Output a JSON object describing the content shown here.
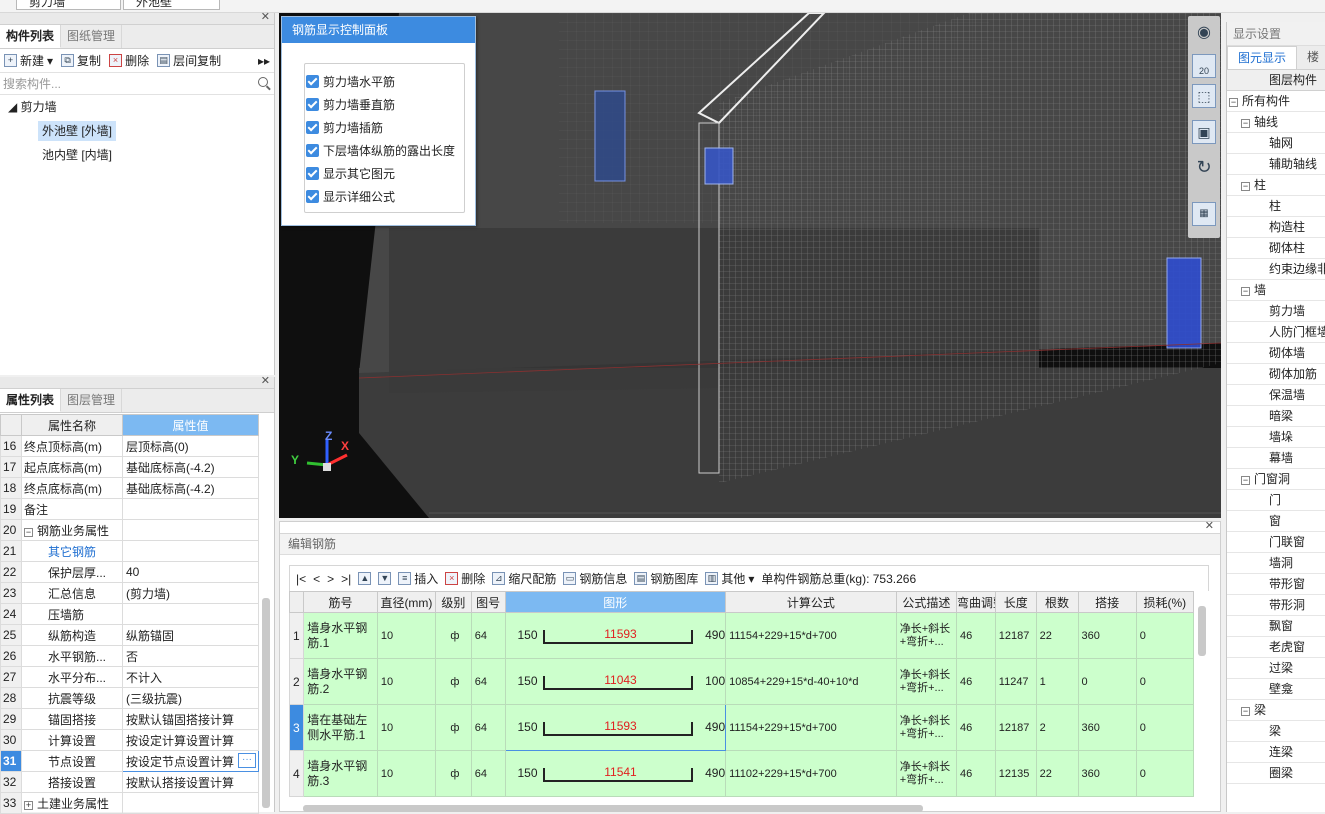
{
  "top": {
    "sel1": "剪力墙",
    "sel2": "外池壁"
  },
  "left": {
    "tabs": [
      "构件列表",
      "图纸管理"
    ],
    "toolbar": {
      "new": "新建",
      "copy": "复制",
      "delete": "删除",
      "floor_copy": "层间复制"
    },
    "search_placeholder": "搜索构件...",
    "tree_root": "剪力墙",
    "tree_items": [
      "外池壁 [外墙]",
      "池内壁 [内墙]"
    ]
  },
  "props": {
    "tabs": [
      "属性列表",
      "图层管理"
    ],
    "col_name": "属性名称",
    "col_value": "属性值",
    "rows": [
      {
        "n": "16",
        "name": "终点顶标高(m)",
        "val": "层顶标高(0)"
      },
      {
        "n": "17",
        "name": "起点底标高(m)",
        "val": "基础底标高(-4.2)"
      },
      {
        "n": "18",
        "name": "终点底标高(m)",
        "val": "基础底标高(-4.2)"
      },
      {
        "n": "19",
        "name": "备注",
        "val": ""
      },
      {
        "n": "20",
        "name": "钢筋业务属性",
        "val": ""
      },
      {
        "n": "21",
        "name": "其它钢筋",
        "val": ""
      },
      {
        "n": "22",
        "name": "保护层厚...",
        "val": "40"
      },
      {
        "n": "23",
        "name": "汇总信息",
        "val": "(剪力墙)"
      },
      {
        "n": "24",
        "name": "压墙筋",
        "val": ""
      },
      {
        "n": "25",
        "name": "纵筋构造",
        "val": "纵筋锚固"
      },
      {
        "n": "26",
        "name": "水平钢筋...",
        "val": "否"
      },
      {
        "n": "27",
        "name": "水平分布...",
        "val": "不计入"
      },
      {
        "n": "28",
        "name": "抗震等级",
        "val": "(三级抗震)"
      },
      {
        "n": "29",
        "name": "锚固搭接",
        "val": "按默认锚固搭接计算"
      },
      {
        "n": "30",
        "name": "计算设置",
        "val": "按设定计算设置计算"
      },
      {
        "n": "31",
        "name": "节点设置",
        "val": "按设定节点设置计算"
      },
      {
        "n": "32",
        "name": "搭接设置",
        "val": "按默认搭接设置计算"
      },
      {
        "n": "33",
        "name": "土建业务属性",
        "val": ""
      }
    ]
  },
  "control": {
    "title": "钢筋显示控制面板",
    "items": [
      "剪力墙水平筋",
      "剪力墙垂直筋",
      "剪力墙插筋",
      "下层墙体纵筋的露出长度",
      "显示其它图元",
      "显示详细公式"
    ]
  },
  "axes": {
    "x": "X",
    "y": "Y",
    "z": "Z"
  },
  "view": {
    "scale_label": "20"
  },
  "right": {
    "title": "显示设置",
    "tabs": [
      "图元显示",
      "楼"
    ],
    "header": "图层构件",
    "rows": [
      {
        "t": "所有构件",
        "lvl": 0,
        "box": "−"
      },
      {
        "t": "轴线",
        "lvl": 1,
        "box": "−"
      },
      {
        "t": "轴网",
        "lvl": 2
      },
      {
        "t": "辅助轴线",
        "lvl": 2
      },
      {
        "t": "柱",
        "lvl": 1,
        "box": "−"
      },
      {
        "t": "柱",
        "lvl": 2
      },
      {
        "t": "构造柱",
        "lvl": 2
      },
      {
        "t": "砌体柱",
        "lvl": 2
      },
      {
        "t": "约束边缘非",
        "lvl": 2
      },
      {
        "t": "墙",
        "lvl": 1,
        "box": "−"
      },
      {
        "t": "剪力墙",
        "lvl": 2
      },
      {
        "t": "人防门框墙",
        "lvl": 2
      },
      {
        "t": "砌体墙",
        "lvl": 2
      },
      {
        "t": "砌体加筋",
        "lvl": 2
      },
      {
        "t": "保温墙",
        "lvl": 2
      },
      {
        "t": "暗梁",
        "lvl": 2
      },
      {
        "t": "墙垛",
        "lvl": 2
      },
      {
        "t": "幕墙",
        "lvl": 2
      },
      {
        "t": "门窗洞",
        "lvl": 1,
        "box": "−"
      },
      {
        "t": "门",
        "lvl": 2
      },
      {
        "t": "窗",
        "lvl": 2
      },
      {
        "t": "门联窗",
        "lvl": 2
      },
      {
        "t": "墙洞",
        "lvl": 2
      },
      {
        "t": "带形窗",
        "lvl": 2
      },
      {
        "t": "带形洞",
        "lvl": 2
      },
      {
        "t": "飘窗",
        "lvl": 2
      },
      {
        "t": "老虎窗",
        "lvl": 2
      },
      {
        "t": "过梁",
        "lvl": 2
      },
      {
        "t": "壁龛",
        "lvl": 2
      },
      {
        "t": "梁",
        "lvl": 1,
        "box": "−"
      },
      {
        "t": "梁",
        "lvl": 2
      },
      {
        "t": "连梁",
        "lvl": 2
      },
      {
        "t": "圈梁",
        "lvl": 2
      }
    ]
  },
  "editor": {
    "title": "编辑钢筋",
    "toolbar": {
      "first": "|<",
      "prev": "<",
      "next": ">",
      "last": ">|",
      "insert": "插入",
      "delete": "删除",
      "scale": "缩尺配筋",
      "info": "钢筋信息",
      "lib": "钢筋图库",
      "other": "其他",
      "total": "单构件钢筋总重(kg): 753.266"
    },
    "headers": [
      "",
      "筋号",
      "直径(mm)",
      "级别",
      "图号",
      "图形",
      "计算公式",
      "公式描述",
      "弯曲调整",
      "长度",
      "根数",
      "搭接",
      "损耗(%)"
    ],
    "rows": [
      {
        "n": "1",
        "name": "墙身水平钢筋.1",
        "dia": "10",
        "grade": "ф",
        "fig": "64",
        "left": "150",
        "mid": "11593",
        "right": "490",
        "formula": "11154+229+15*d+700",
        "desc": "净长+斜长+弯折+...",
        "bend": "46",
        "len": "12187",
        "count": "22",
        "lap": "360",
        "loss": "0"
      },
      {
        "n": "2",
        "name": "墙身水平钢筋.2",
        "dia": "10",
        "grade": "ф",
        "fig": "64",
        "left": "150",
        "mid": "11043",
        "right": "100",
        "formula": "10854+229+15*d-40+10*d",
        "desc": "净长+斜长+弯折+...",
        "bend": "46",
        "len": "11247",
        "count": "1",
        "lap": "0",
        "loss": "0"
      },
      {
        "n": "3",
        "name": "墙在基础左侧水平筋.1",
        "dia": "10",
        "grade": "ф",
        "fig": "64",
        "left": "150",
        "mid": "11593",
        "right": "490",
        "formula": "11154+229+15*d+700",
        "desc": "净长+斜长+弯折+...",
        "bend": "46",
        "len": "12187",
        "count": "2",
        "lap": "360",
        "loss": "0"
      },
      {
        "n": "4",
        "name": "墙身水平钢筋.3",
        "dia": "10",
        "grade": "ф",
        "fig": "64",
        "left": "150",
        "mid": "11541",
        "right": "490",
        "formula": "11102+229+15*d+700",
        "desc": "净长+斜长+弯折+...",
        "bend": "46",
        "len": "12135",
        "count": "22",
        "lap": "360",
        "loss": "0"
      }
    ]
  }
}
